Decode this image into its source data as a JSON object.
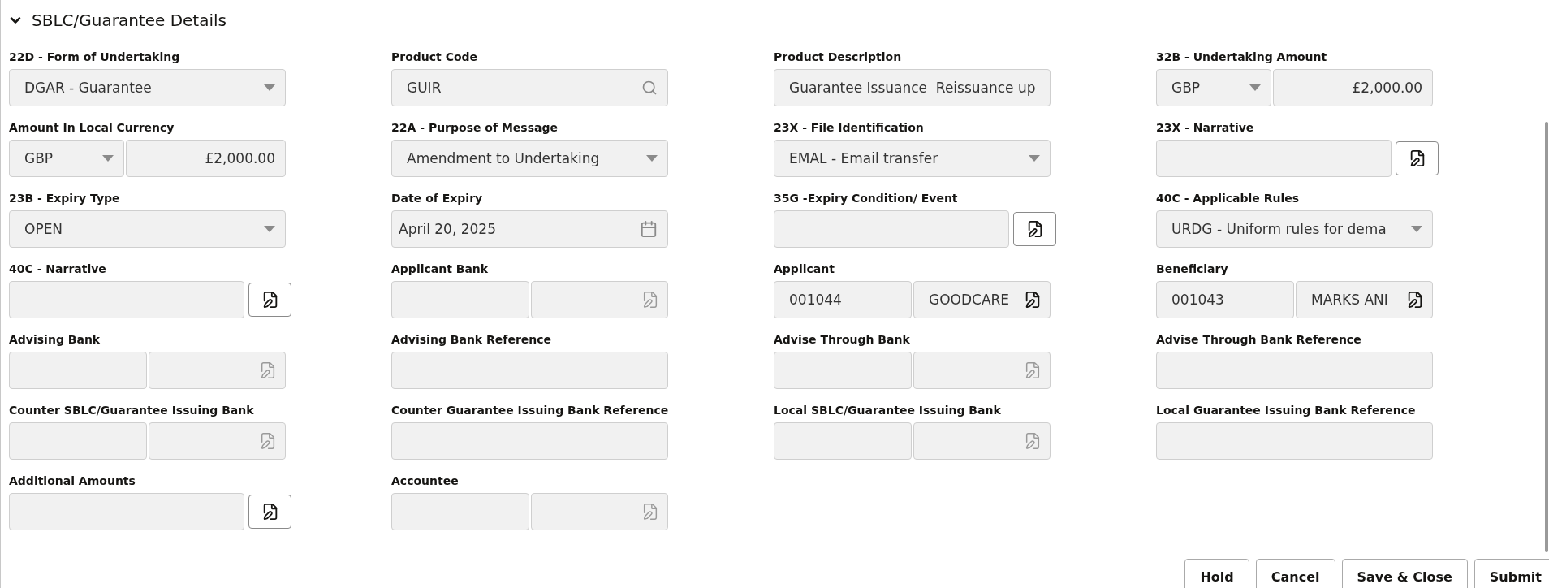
{
  "section": {
    "title": "SBLC/Guarantee Details",
    "expanded": true
  },
  "rows": [
    [
      {
        "label": "22D - Form of Undertaking",
        "kind": "select",
        "value": "DGAR - Guarantee"
      },
      {
        "label": "Product Code",
        "kind": "search",
        "value": "GUIR"
      },
      {
        "label": "Product Description",
        "kind": "text",
        "value": "Guarantee Issuance  Reissuance up"
      },
      {
        "label": "32B - Undertaking Amount",
        "kind": "currency",
        "currency": "GBP",
        "amount": "£2,000.00"
      }
    ],
    [
      {
        "label": "Amount In Local Currency",
        "kind": "currency",
        "currency": "GBP",
        "amount": "£2,000.00"
      },
      {
        "label": "22A - Purpose of Message",
        "kind": "select",
        "value": "Amendment to Undertaking"
      },
      {
        "label": "23X - File Identification",
        "kind": "select",
        "value": "EMAL - Email transfer"
      },
      {
        "label": "23X - Narrative",
        "kind": "narrative"
      }
    ],
    [
      {
        "label": "23B - Expiry Type",
        "kind": "select",
        "value": "OPEN"
      },
      {
        "label": "Date of Expiry",
        "kind": "date",
        "value": "April 20, 2025"
      },
      {
        "label": "35G -Expiry Condition/ Event",
        "kind": "narrative"
      },
      {
        "label": "40C - Applicable Rules",
        "kind": "select",
        "value": "URDG - Uniform rules for dema"
      }
    ],
    [
      {
        "label": "40C - Narrative",
        "kind": "narrative"
      },
      {
        "label": "Applicant Bank",
        "kind": "pair",
        "enabled": false
      },
      {
        "label": "Applicant",
        "kind": "pair",
        "code": "001044",
        "name": "GOODCARE",
        "enabled": true
      },
      {
        "label": "Beneficiary",
        "kind": "pair",
        "code": "001043",
        "name": "MARKS ANI",
        "enabled": true
      }
    ],
    [
      {
        "label": "Advising Bank",
        "kind": "pair",
        "enabled": false
      },
      {
        "label": "Advising Bank Reference",
        "kind": "text"
      },
      {
        "label": "Advise Through Bank",
        "kind": "pair",
        "enabled": false
      },
      {
        "label": "Advise Through Bank Reference",
        "kind": "text"
      }
    ],
    [
      {
        "label": "Counter SBLC/Guarantee Issuing Bank",
        "kind": "pair",
        "enabled": false
      },
      {
        "label": "Counter Guarantee Issuing Bank Reference",
        "kind": "text"
      },
      {
        "label": "Local SBLC/Guarantee Issuing Bank",
        "kind": "pair",
        "enabled": false
      },
      {
        "label": "Local Guarantee Issuing Bank Reference",
        "kind": "text"
      }
    ],
    [
      {
        "label": "Additional Amounts",
        "kind": "narrative"
      },
      {
        "label": "Accountee",
        "kind": "pair",
        "enabled": false
      }
    ]
  ],
  "buttons": [
    "Hold",
    "Cancel",
    "Save & Close",
    "Submit"
  ]
}
